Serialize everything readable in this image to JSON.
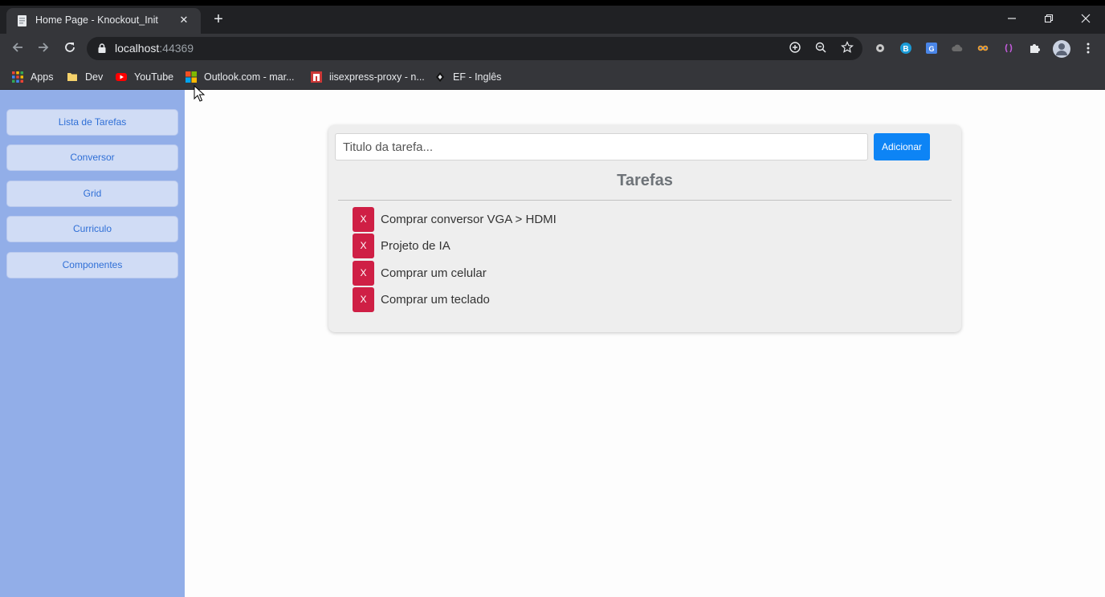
{
  "browser": {
    "tab_title": "Home Page - Knockout_Init",
    "tab_close": "✕",
    "new_tab": "+",
    "url_host": "localhost",
    "url_port": ":44369",
    "bookmarks": [
      {
        "label": "Apps",
        "icon": "apps-grid-icon"
      },
      {
        "label": "Dev",
        "icon": "folder-icon"
      },
      {
        "label": "YouTube",
        "icon": "youtube-icon"
      },
      {
        "label": "Outlook.com - mar...",
        "icon": "microsoft-icon"
      },
      {
        "label": "iisexpress-proxy - n...",
        "icon": "npm-icon"
      },
      {
        "label": "EF - Inglês",
        "icon": "ef-icon"
      }
    ]
  },
  "sidebar": {
    "items": [
      {
        "label": "Lista de Tarefas"
      },
      {
        "label": "Conversor"
      },
      {
        "label": "Grid"
      },
      {
        "label": "Curriculo"
      },
      {
        "label": "Componentes"
      }
    ]
  },
  "main": {
    "input_placeholder": "Titulo da tarefa...",
    "add_label": "Adicionar",
    "heading": "Tarefas",
    "delete_label": "X",
    "tasks": [
      "Comprar conversor VGA > HDMI",
      "Projeto de IA",
      "Comprar um celular",
      "Comprar um teclado"
    ]
  },
  "colors": {
    "sidebar_bg": "#92aee8",
    "primary": "#0d84f5",
    "danger": "#cf1f45"
  }
}
